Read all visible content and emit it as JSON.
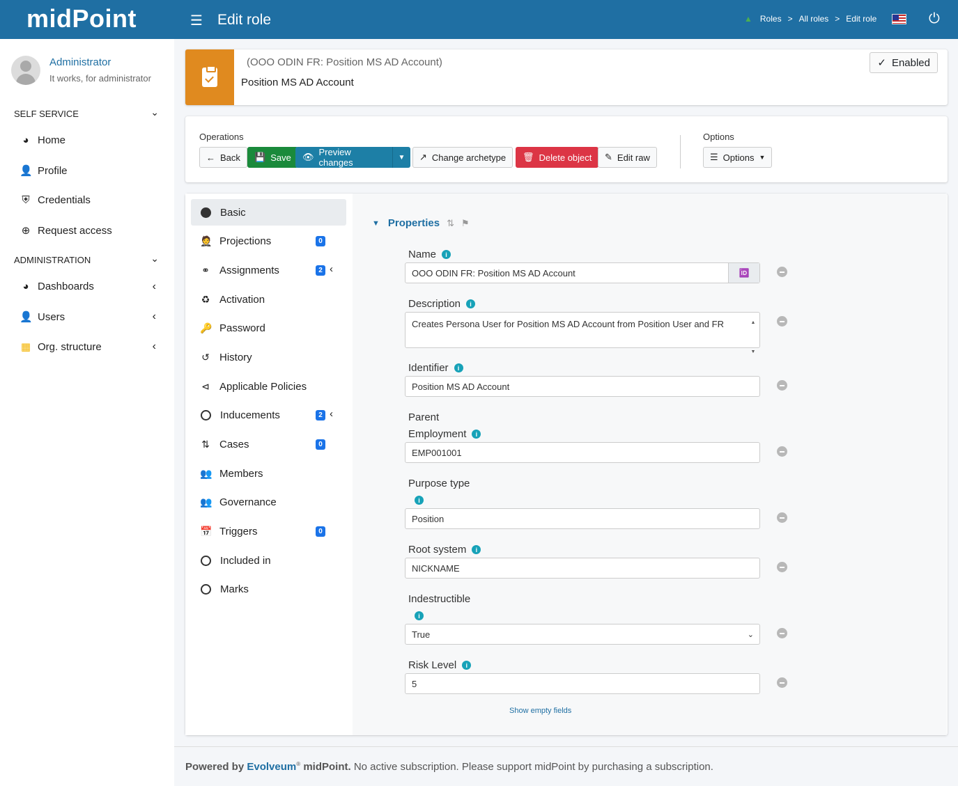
{
  "header": {
    "brand": "midPoint",
    "page_title": "Edit role",
    "breadcrumbs": [
      "Roles",
      "All roles",
      "Edit role"
    ],
    "breadcrumb_sep": ">"
  },
  "user": {
    "name": "Administrator",
    "subtitle": "It works, for administrator"
  },
  "sidebar": {
    "self_service": "SELF SERVICE",
    "self_items": [
      "Home",
      "Profile",
      "Credentials",
      "Request access"
    ],
    "administration": "ADMINISTRATION",
    "admin_items": [
      "Dashboards",
      "Users",
      "Org. structure"
    ]
  },
  "record": {
    "subtitle": "(OOO ODIN FR: Position MS AD Account)",
    "title": "Position MS AD Account",
    "status": "Enabled"
  },
  "operations": {
    "label": "Operations",
    "back": "Back",
    "save": "Save",
    "preview": "Preview changes",
    "archetype": "Change archetype",
    "delete": "Delete object",
    "edit_raw": "Edit raw",
    "options_label": "Options",
    "options": "Options"
  },
  "tabs": [
    {
      "label": "Basic"
    },
    {
      "label": "Projections",
      "badge": "0"
    },
    {
      "label": "Assignments",
      "badge": "2"
    },
    {
      "label": "Activation"
    },
    {
      "label": "Password"
    },
    {
      "label": "History"
    },
    {
      "label": "Applicable Policies"
    },
    {
      "label": "Inducements",
      "badge": "2"
    },
    {
      "label": "Cases",
      "badge": "0"
    },
    {
      "label": "Members"
    },
    {
      "label": "Governance"
    },
    {
      "label": "Triggers",
      "badge": "0"
    },
    {
      "label": "Included in"
    },
    {
      "label": "Marks"
    }
  ],
  "properties": {
    "title": "Properties",
    "name_label": "Name",
    "name_value": "OOO ODIN FR: Position MS AD Account",
    "desc_label": "Description",
    "desc_value": "Creates Persona User for Position MS AD Account from Position User and FR",
    "identifier_label": "Identifier",
    "identifier_value": "Position MS AD Account",
    "parent_label": "Parent",
    "employment_label": "Employment",
    "employment_value": "EMP001001",
    "purpose_label": "Purpose type",
    "purpose_value": "Position",
    "root_label": "Root system",
    "root_value": "NICKNAME",
    "indestructible_label": "Indestructible",
    "indestructible_value": "True",
    "risk_label": "Risk Level",
    "risk_value": "5",
    "show_empty": "Show empty fields"
  },
  "footer": {
    "powered": "Powered by",
    "vendor": "Evolveum",
    "product": "midPoint.",
    "message": "No active subscription. Please support midPoint by purchasing a subscription."
  }
}
